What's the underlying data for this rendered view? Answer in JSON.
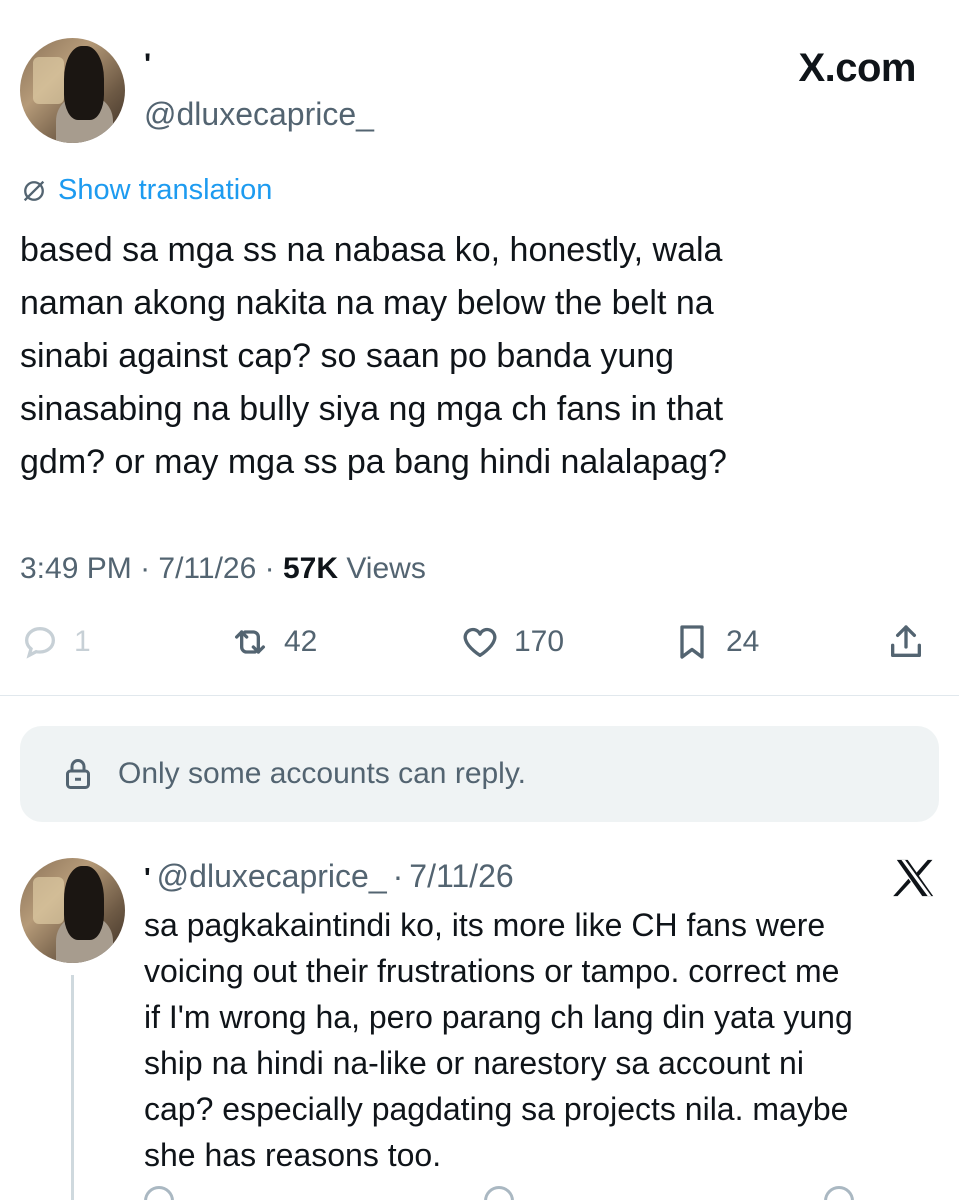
{
  "header": {
    "brand": "X.com",
    "name_mark": "'",
    "handle": "@dluxecaprice_"
  },
  "tweet": {
    "translate_label": "Show translation",
    "text": "based sa mga ss na nabasa ko, honestly, wala\nnaman akong nakita na may below the belt na\nsinabi against cap? so saan po banda yung\nsinasabing na bully siya ng mga ch fans in that\ngdm? or may mga ss pa bang hindi nalalapag?",
    "time": "3:49 PM",
    "date": "7/11/26",
    "views_count": "57K",
    "views_label": "Views"
  },
  "actions": {
    "replies": "1",
    "reposts": "42",
    "likes": "170",
    "bookmarks": "24"
  },
  "restriction": {
    "label": "Only some accounts can reply."
  },
  "reply": {
    "name_mark": "'",
    "handle": "@dluxecaprice_",
    "separator": "·",
    "date": "7/11/26",
    "text": "sa pagkakaintindi ko, its more like CH fans  were\nvoicing out their frustrations or tampo. correct me\nif I'm wrong ha, pero parang ch lang din yata yung\nship na hindi na-like or narestory sa account ni\ncap? especially pagdating sa projects nila. maybe\nshe has reasons too."
  },
  "colors": {
    "text": "#0f1419",
    "secondary": "#536471",
    "accent": "#1d9bf0",
    "restriction_bg": "#eff3f4"
  },
  "icons": [
    "translate-icon",
    "reply-icon",
    "repost-icon",
    "like-icon",
    "bookmark-icon",
    "share-icon",
    "lock-icon",
    "x-logo-icon"
  ]
}
